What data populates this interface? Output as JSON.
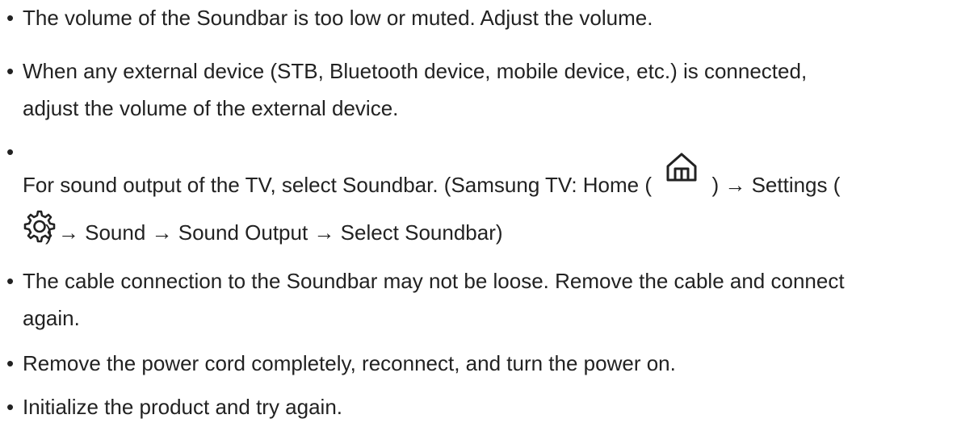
{
  "bullet": "•",
  "items": [
    {
      "text": "The volume of the Soundbar is too low or muted. Adjust the volume."
    },
    {
      "line1": "When any external device (STB, Bluetooth device, mobile device, etc.) is connected,",
      "line2": "adjust the volume of the external device."
    },
    {
      "part1": "For sound output of the TV, select Soundbar. (Samsung TV: Home ( ",
      "icon1": "home-icon",
      "part2": " ) → Settings (",
      "icon2": "gear-icon",
      "part3": ") → Sound → Sound Output → Select Soundbar)"
    },
    {
      "line1": "The cable connection to the Soundbar may not be loose. Remove the cable and connect",
      "line2": "again."
    },
    {
      "text": "Remove the power cord completely, reconnect, and turn the power on."
    },
    {
      "text": "Initialize the product and try again."
    }
  ]
}
